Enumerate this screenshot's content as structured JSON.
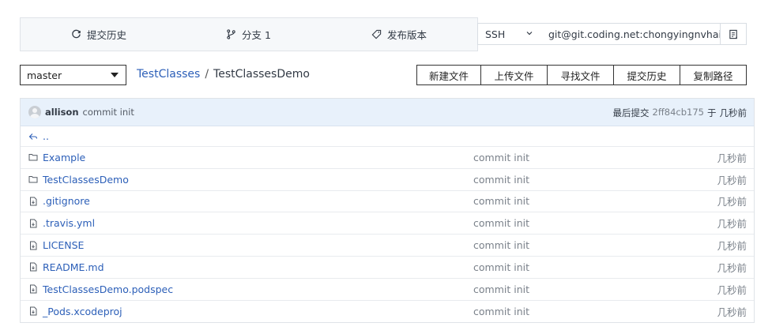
{
  "stats": {
    "history_label": "提交历史",
    "branches_label": "分支 1",
    "releases_label": "发布版本"
  },
  "clone": {
    "protocol": "SSH",
    "url": "git@git.coding.net:chongyingnvhai/"
  },
  "branch": {
    "current": "master"
  },
  "breadcrumb": {
    "root": "TestClasses",
    "separator": "/",
    "current": "TestClassesDemo"
  },
  "actions": {
    "new_file": "新建文件",
    "upload_file": "上传文件",
    "find_file": "寻找文件",
    "history": "提交历史",
    "copy_path": "复制路径"
  },
  "commit": {
    "author": "allison",
    "message": "commit init",
    "latest_label": "最后提交",
    "hash": "2ff84cb175",
    "at_label": "于",
    "time": "几秒前"
  },
  "parent_link": "..",
  "files": [
    {
      "name": "Example",
      "type": "folder",
      "message": "commit init",
      "time": "几秒前"
    },
    {
      "name": "TestClassesDemo",
      "type": "folder",
      "message": "commit init",
      "time": "几秒前"
    },
    {
      "name": ".gitignore",
      "type": "file",
      "message": "commit init",
      "time": "几秒前"
    },
    {
      "name": ".travis.yml",
      "type": "file",
      "message": "commit init",
      "time": "几秒前"
    },
    {
      "name": "LICENSE",
      "type": "file",
      "message": "commit init",
      "time": "几秒前"
    },
    {
      "name": "README.md",
      "type": "file",
      "message": "commit init",
      "time": "几秒前"
    },
    {
      "name": "TestClassesDemo.podspec",
      "type": "file",
      "message": "commit init",
      "time": "几秒前"
    },
    {
      "name": "_Pods.xcodeproj",
      "type": "file",
      "message": "commit init",
      "time": "几秒前"
    }
  ],
  "colors": {
    "link": "#2c5fb8",
    "header_bg": "#e8f1fb",
    "bar_bg": "#f6f8fa"
  }
}
